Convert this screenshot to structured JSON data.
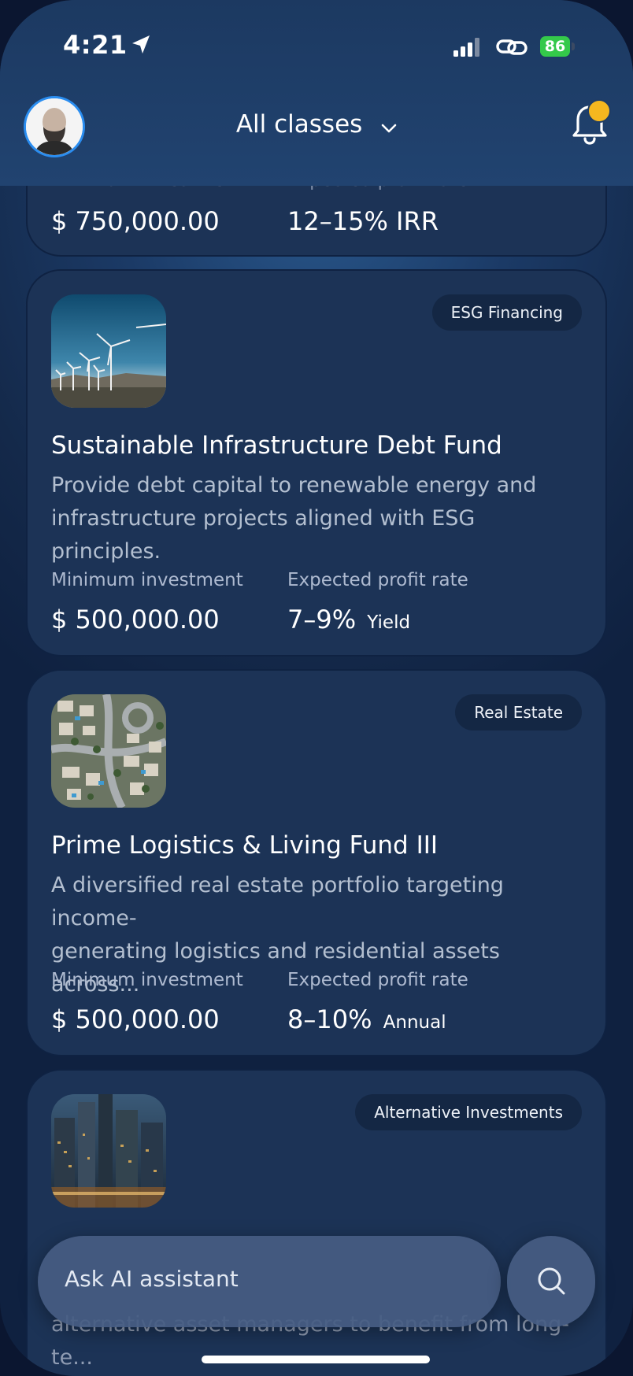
{
  "status_bar": {
    "time": "4:21",
    "battery": "86",
    "battery_color": "#34c94a"
  },
  "header": {
    "title": "All classes",
    "notification_dot_color": "#f5b71f"
  },
  "cards": [
    {
      "min_label": "Minimum investment",
      "min_value": "$ 750,000.00",
      "rate_label": "Expected profit rate",
      "rate_value": "12–15% IRR"
    },
    {
      "badge": "ESG Financing",
      "title": "Sustainable Infrastructure Debt Fund",
      "desc_line1": "Provide debt capital to renewable energy and",
      "desc_line2": "infrastructure projects aligned with ESG principles.",
      "min_label": "Minimum investment",
      "min_value": "$ 500,000.00",
      "rate_label": "Expected profit rate",
      "rate_value": "7–9%",
      "rate_unit": "Yield"
    },
    {
      "badge": "Real Estate",
      "title": "Prime Logistics & Living Fund III",
      "desc_line1": "A diversified real estate portfolio targeting income-",
      "desc_line2": "generating logistics and residential assets across...",
      "min_label": "Minimum investment",
      "min_value": "$ 500,000.00",
      "rate_label": "Expected profit rate",
      "rate_value": "8–10%",
      "rate_unit": "Annual"
    },
    {
      "badge": "Alternative Investments",
      "desc_line2": "alternative asset managers to benefit from long-te..."
    }
  ],
  "assistant": {
    "placeholder": "Ask AI assistant"
  }
}
